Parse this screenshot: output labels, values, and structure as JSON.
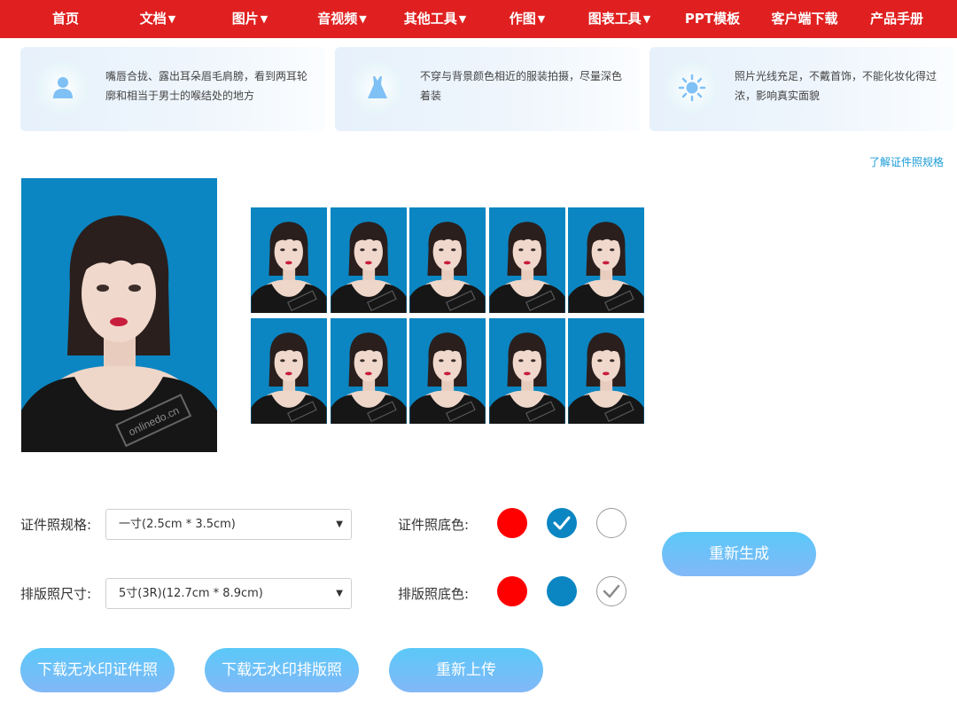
{
  "nav": [
    {
      "label": "首页",
      "dropdown": false
    },
    {
      "label": "文档",
      "dropdown": true
    },
    {
      "label": "图片",
      "dropdown": true
    },
    {
      "label": "音视频",
      "dropdown": true
    },
    {
      "label": "其他工具",
      "dropdown": true
    },
    {
      "label": "作图",
      "dropdown": true
    },
    {
      "label": "图表工具",
      "dropdown": true
    },
    {
      "label": "PPT模板",
      "dropdown": false
    },
    {
      "label": "客户端下载",
      "dropdown": false
    },
    {
      "label": "产品手册",
      "dropdown": false
    }
  ],
  "tips": [
    {
      "icon": "person-icon",
      "text": "嘴唇合拢、露出耳朵眉毛肩膀，看到两耳轮廓和相当于男士的喉结处的地方"
    },
    {
      "icon": "dress-icon",
      "text": "不穿与背景颜色相近的服装拍摄，尽量深色着装"
    },
    {
      "icon": "sun-icon",
      "text": "照片光线充足，不戴首饰，不能化妆化得过浓，影响真实面貌"
    }
  ],
  "spec_link": "了解证件照规格",
  "watermark": "onlinedo.cn",
  "photo_bg_color": "#0b86c2",
  "thumb_count": 10,
  "controls": {
    "size_label": "证件照规格:",
    "size_value": "一寸(2.5cm * 3.5cm)",
    "layout_label": "排版照尺寸:",
    "layout_value": "5寸(3R)(12.7cm * 8.9cm)",
    "bg_label": "证件照底色:",
    "layout_bg_label": "排版照底色:",
    "colors": {
      "red": "#ff0000",
      "blue": "#0b86c2",
      "white": "#ffffff"
    },
    "bg_selected": "blue",
    "layout_bg_selected": "white"
  },
  "buttons": {
    "regenerate": "重新生成",
    "download_id": "下载无水印证件照",
    "download_layout": "下载无水印排版照",
    "reupload": "重新上传"
  }
}
